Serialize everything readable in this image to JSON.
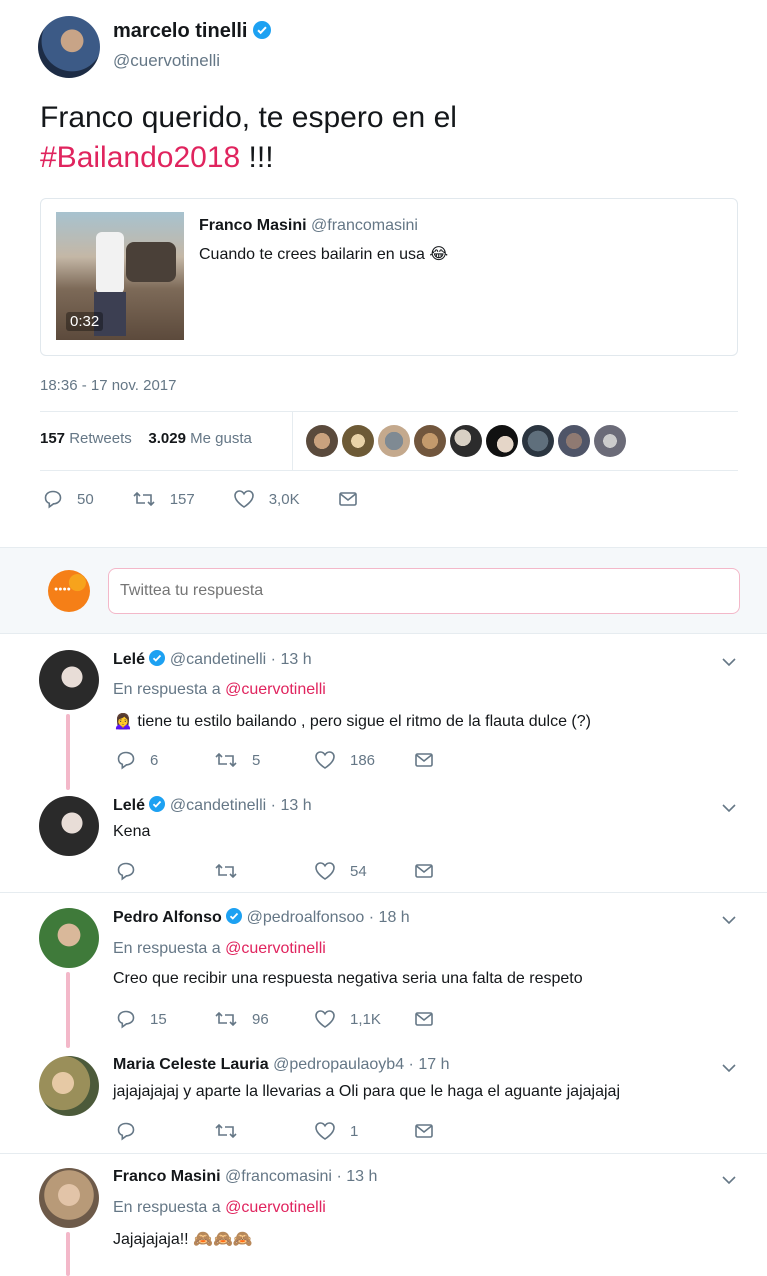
{
  "tweet": {
    "name": "marcelo tinelli",
    "handle": "@cuervotinelli",
    "text_plain": "Franco querido, te espero en el",
    "hashtag": "#Bailando2018",
    "text_end": " !!!",
    "quote": {
      "name": "Franco Masini",
      "handle": "@francomasini",
      "text": "Cuando te crees bailarin en usa 😂",
      "duration": "0:32"
    },
    "timestamp": "18:36 - 17 nov. 2017",
    "retweets_count": "157",
    "retweets_label": "Retweets",
    "likes_count": "3.029",
    "likes_label": "Me gusta",
    "actions": {
      "replies": "50",
      "retweets": "157",
      "likes": "3,0K"
    }
  },
  "reply_box": {
    "placeholder": "Twittea tu respuesta"
  },
  "replies": [
    {
      "name": "Lelé",
      "handle": "@candetinelli",
      "time": "· 13 h",
      "in_reply_prefix": "En respuesta a",
      "in_reply_handle": "@cuervotinelli",
      "text": "🙍‍♀️ tiene tu estilo bailando , pero sigue el ritmo de la flauta dulce (?)",
      "replies": "6",
      "retweets": "5",
      "likes": "186"
    },
    {
      "name": "Lelé",
      "handle": "@candetinelli",
      "time": "· 13 h",
      "text": "Kena",
      "replies": "",
      "retweets": "",
      "likes": "54"
    },
    {
      "name": "Pedro Alfonso",
      "handle": "@pedroalfonsoo",
      "time": "· 18 h",
      "in_reply_prefix": "En respuesta a",
      "in_reply_handle": "@cuervotinelli",
      "text": "Creo que recibir una respuesta negativa seria una falta de respeto",
      "replies": "15",
      "retweets": "96",
      "likes": "1,1K"
    },
    {
      "name": "Maria Celeste Lauria",
      "handle": "@pedropaulaoyb4",
      "time": "· 17 h",
      "text": "jajajajajaj y aparte la llevarias a Oli para que le haga  el aguante jajajajaj",
      "replies": "",
      "retweets": "",
      "likes": "1"
    },
    {
      "name": "Franco Masini",
      "handle": "@francomasini",
      "time": "· 13 h",
      "in_reply_prefix": "En respuesta a",
      "in_reply_handle": "@cuervotinelli",
      "text": "Jajajajaja!! 🙈🙈🙈"
    }
  ],
  "colors": {
    "accent": "#e0245e",
    "verified": "#1da1f2",
    "muted": "#657786",
    "thread": "#f3b8c9"
  }
}
